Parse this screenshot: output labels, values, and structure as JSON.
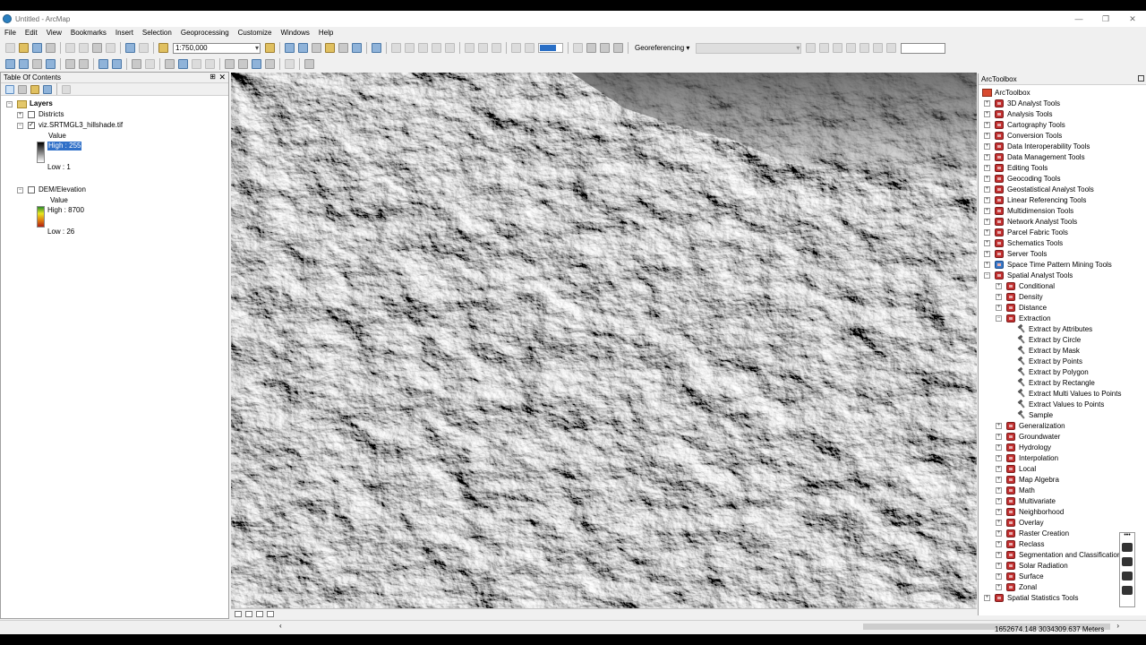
{
  "window": {
    "title": "Untitled - ArcMap",
    "minimize": "—",
    "maximize": "❐",
    "close": "✕"
  },
  "menu": [
    "File",
    "Edit",
    "View",
    "Bookmarks",
    "Insert",
    "Selection",
    "Geoprocessing",
    "Customize",
    "Windows",
    "Help"
  ],
  "toolbar": {
    "scale": "1:750,000",
    "georeferencing_label": "Georeferencing ▾"
  },
  "toc": {
    "title": "Table Of Contents",
    "pin": "⊞",
    "close": "✕",
    "root": "Layers",
    "layers": [
      {
        "name": "Districts",
        "checked": false,
        "expanded": false
      },
      {
        "name": "viz.SRTMGL3_hillshade.tif",
        "checked": true,
        "expanded": true,
        "field": "Value",
        "high": "High : 255",
        "low": "Low : 1"
      },
      {
        "name": "DEM/Elevation",
        "checked": false,
        "expanded": true,
        "field": "Value",
        "high": "High : 8700",
        "low": "Low : 26"
      }
    ],
    "expand_plus": "+",
    "expand_minus": "−",
    "check_mark": "✓"
  },
  "arctoolbox": {
    "title": "ArcToolbox",
    "root": "ArcToolbox",
    "toolboxes": [
      "3D Analyst Tools",
      "Analysis Tools",
      "Cartography Tools",
      "Conversion Tools",
      "Data Interoperability Tools",
      "Data Management Tools",
      "Editing Tools",
      "Geocoding Tools",
      "Geostatistical Analyst Tools",
      "Linear Referencing Tools",
      "Multidimension Tools",
      "Network Analyst Tools",
      "Parcel Fabric Tools",
      "Schematics Tools",
      "Server Tools",
      "Space Time Pattern Mining Tools"
    ],
    "spatial_analyst": "Spatial Analyst Tools",
    "sa_before": [
      "Conditional",
      "Density",
      "Distance"
    ],
    "extraction": "Extraction",
    "extraction_tools": [
      "Extract by Attributes",
      "Extract by Circle",
      "Extract by Mask",
      "Extract by Points",
      "Extract by Polygon",
      "Extract by Rectangle",
      "Extract Multi Values to Points",
      "Extract Values to Points",
      "Sample"
    ],
    "sa_after": [
      "Generalization",
      "Groundwater",
      "Hydrology",
      "Interpolation",
      "Local",
      "Map Algebra",
      "Math",
      "Multivariate",
      "Neighborhood",
      "Overlay",
      "Raster Creation",
      "Reclass",
      "Segmentation and Classification",
      "Solar Radiation",
      "Surface",
      "Zonal"
    ],
    "last": "Spatial Statistics Tools"
  },
  "status": {
    "coordinates": "1652674.148  3034309.637 Meters",
    "scroll_left": "‹",
    "scroll_right": "›"
  }
}
